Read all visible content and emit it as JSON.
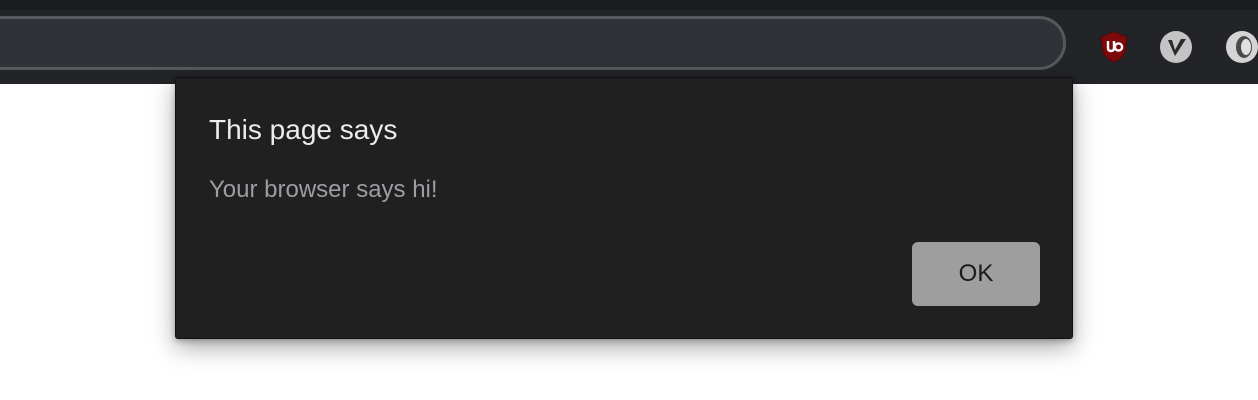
{
  "browser": {
    "extensions": [
      {
        "icon": "ublock-origin-icon",
        "color": "#800000"
      },
      {
        "icon": "v-extension-icon",
        "color": "#c8c8c8"
      },
      {
        "icon": "ring-extension-icon",
        "color": "#d0d0d0"
      }
    ]
  },
  "dialog": {
    "title": "This page says",
    "message": "Your browser says hi!",
    "ok_label": "OK"
  }
}
